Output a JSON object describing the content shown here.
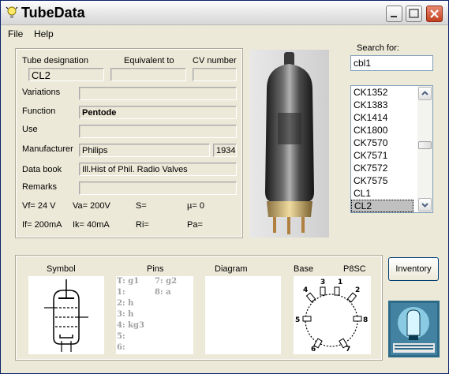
{
  "window": {
    "title": "TubeData"
  },
  "menu": {
    "file": "File",
    "help": "Help"
  },
  "form": {
    "tube_designation_label": "Tube designation",
    "equivalent_label": "Equivalent to",
    "cv_label": "CV number",
    "tube_designation": "CL2",
    "equivalent": "",
    "cv_number": "",
    "variations_label": "Variations",
    "variations": "",
    "function_label": "Function",
    "function": "Pentode",
    "use_label": "Use",
    "use": "",
    "manufacturer_label": "Manufacturer",
    "manufacturer": "Philips",
    "year": "1934",
    "databook_label": "Data book",
    "databook": "Ill.Hist of Phil. Radio Valves",
    "remarks_label": "Remarks",
    "remarks": "",
    "vf": "Vf= 24 V",
    "va": "Va= 200V",
    "s": "S=",
    "mu": "µ=   0",
    "if": "If= 200mA",
    "ik": "Ik=  40mA",
    "ri": "Ri=",
    "pa": "Pa="
  },
  "search": {
    "label": "Search for:",
    "value": "cbl1",
    "results": [
      "CK1352",
      "CK1383",
      "CK1414",
      "CK1800",
      "CK7570",
      "CK7571",
      "CK7572",
      "CK7575",
      "CL1",
      "CL2"
    ],
    "selected": "CL2"
  },
  "bottom": {
    "symbol_label": "Symbol",
    "pins_label": "Pins",
    "diagram_label": "Diagram",
    "base_label": "Base",
    "base_type": "P8SC",
    "pins_left": [
      "T: g1",
      "1:",
      "2: h",
      "3: h",
      "4: kg3",
      "5:",
      "6:"
    ],
    "pins_right": [
      "7: g2",
      "8: a"
    ],
    "base_numbers": [
      "1",
      "2",
      "3",
      "4",
      "5",
      "6",
      "7",
      "8"
    ]
  },
  "buttons": {
    "inventory": "Inventory"
  },
  "colors": {
    "title_bar": "#e4e4e4",
    "close_button": "#c3401f",
    "selection": "#c0c0c0",
    "window_bg": "#ece9d8"
  }
}
